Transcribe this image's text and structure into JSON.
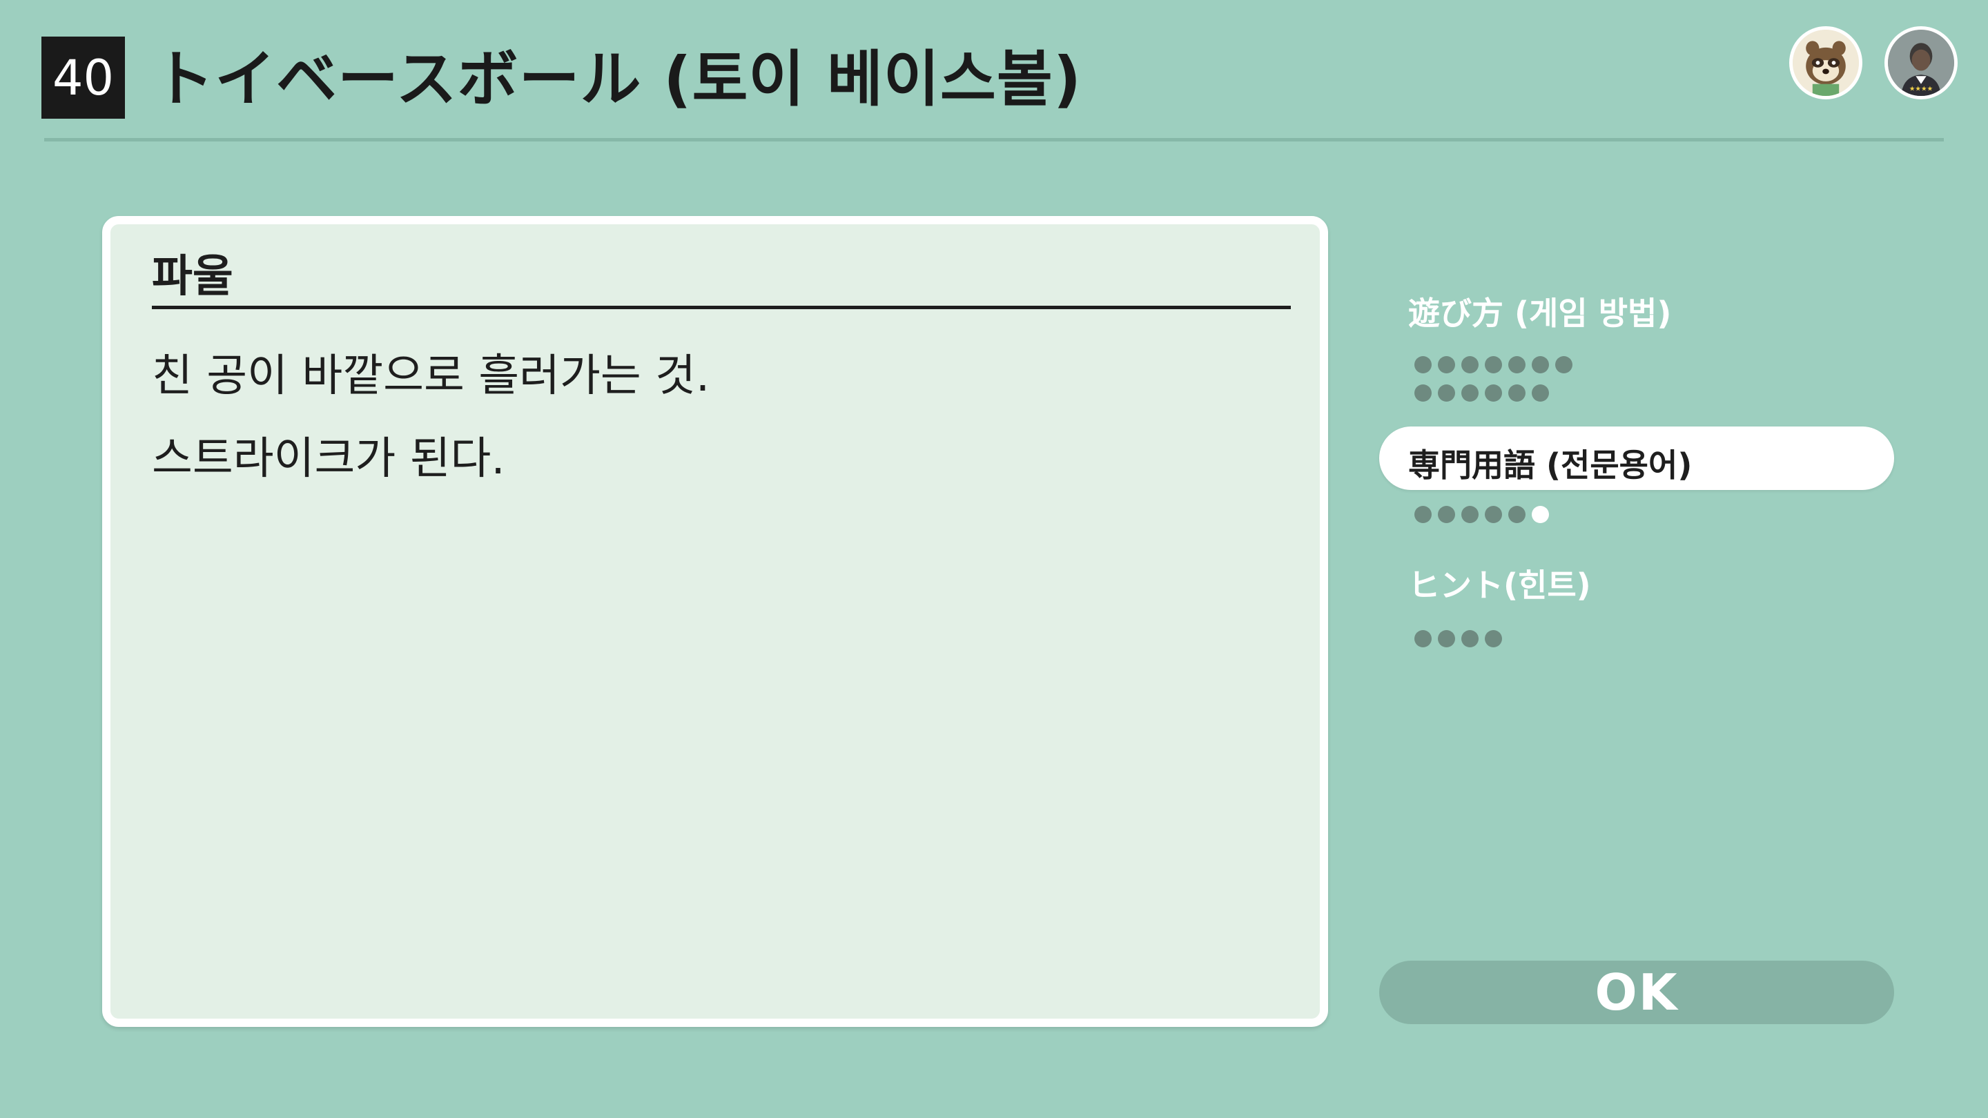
{
  "header": {
    "game_number": "40",
    "title": "トイベースボール (토이 베이스볼)"
  },
  "card": {
    "term": "파울",
    "definition_line_1": "친 공이 바깥으로 흘러가는 것.",
    "definition_line_2": "스트라이크가 된다."
  },
  "menu": {
    "items": [
      {
        "label": "遊び方 (게임 방법)",
        "dot_count": 13,
        "selected": false
      },
      {
        "label": "専門用語 (전문용어)",
        "dot_count": 6,
        "current_index": 6,
        "selected": true
      },
      {
        "label": "ヒント(힌트)",
        "dot_count": 4,
        "selected": false
      }
    ]
  },
  "ok_button": {
    "label": "OK"
  },
  "avatars": [
    {
      "icon": "raccoon-character-avatar-icon"
    },
    {
      "icon": "user-profile-avatar-icon"
    }
  ],
  "colors": {
    "background": "#9dcfbf",
    "card_background": "#e3f0e6",
    "ok_button": "#86b3a5",
    "dot": "#6e8a80"
  }
}
